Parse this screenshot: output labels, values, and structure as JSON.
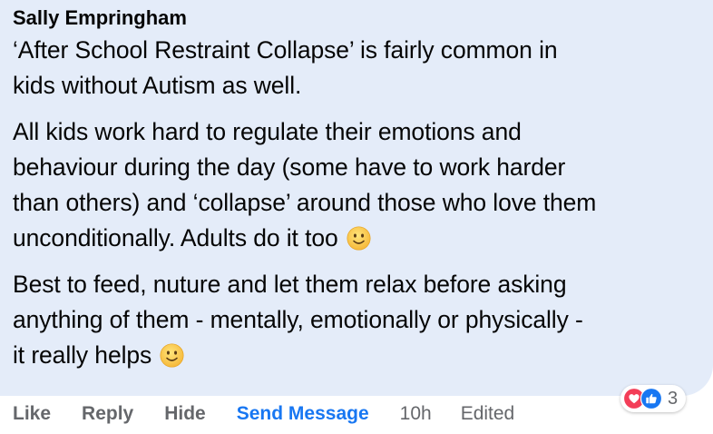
{
  "comment": {
    "author": "Sally Empringham",
    "paragraphs": [
      {
        "lines": [
          "‘After School Restraint Collapse’ is fairly common in",
          "kids without Autism as well."
        ]
      },
      {
        "lines": [
          "All kids work hard to regulate their emotions and",
          "behaviour during the day (some have to work harder",
          "than others) and ‘collapse’ around those who love them",
          "unconditionally. Adults do it too"
        ],
        "end_emoji": "slightly-smiling-face"
      },
      {
        "lines": [
          "Best to feed, nuture and let them relax before asking",
          "anything of them - mentally, emotionally or physically -",
          "it really helps"
        ],
        "end_emoji": "slightly-smiling-face"
      }
    ]
  },
  "actions": {
    "like": "Like",
    "reply": "Reply",
    "hide": "Hide",
    "send_message": "Send Message",
    "time": "10h",
    "edited": "Edited"
  },
  "reactions": {
    "icons": [
      "love-icon",
      "like-icon"
    ],
    "count": "3"
  },
  "colors": {
    "bubble": "#e4ecf9",
    "text": "#050505",
    "meta": "#65676b",
    "link": "#1877f2",
    "love": "#f33e58",
    "like": "#1877f2"
  }
}
